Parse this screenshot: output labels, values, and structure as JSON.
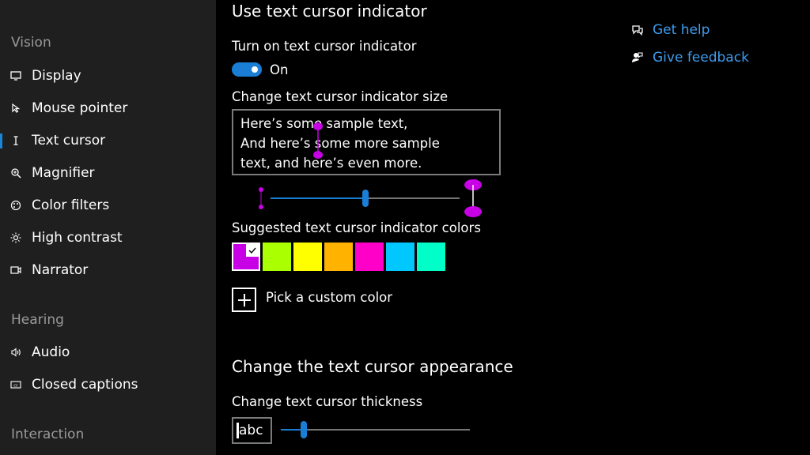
{
  "sidebar": {
    "sections": [
      {
        "header": "Vision",
        "items": [
          {
            "label": "Display",
            "icon": "display-icon"
          },
          {
            "label": "Mouse pointer",
            "icon": "mouse-pointer-icon"
          },
          {
            "label": "Text cursor",
            "icon": "text-cursor-icon",
            "selected": true
          },
          {
            "label": "Magnifier",
            "icon": "magnifier-icon"
          },
          {
            "label": "Color filters",
            "icon": "color-filters-icon"
          },
          {
            "label": "High contrast",
            "icon": "high-contrast-icon"
          },
          {
            "label": "Narrator",
            "icon": "narrator-icon"
          }
        ]
      },
      {
        "header": "Hearing",
        "items": [
          {
            "label": "Audio",
            "icon": "audio-icon"
          },
          {
            "label": "Closed captions",
            "icon": "closed-captions-icon"
          }
        ]
      },
      {
        "header": "Interaction",
        "items": []
      }
    ]
  },
  "main": {
    "title": "Use text cursor indicator",
    "toggle_label": "Turn on text cursor indicator",
    "toggle_state": "On",
    "toggle_on": true,
    "size_label": "Change text cursor indicator size",
    "sample_lines": [
      "Here’s some sample text,",
      "And here’s some more sample",
      "text, and here’s even more."
    ],
    "size_slider_value": 0.5,
    "colors_label": "Suggested text cursor indicator colors",
    "colors": [
      "#c800e6",
      "#aaff00",
      "#ffff00",
      "#ffb300",
      "#ff00c8",
      "#00c8ff",
      "#00ffc8"
    ],
    "selected_color_index": 0,
    "custom_color_label": "Pick a custom color",
    "section2_title": "Change the text cursor appearance",
    "thickness_label": "Change text cursor thickness",
    "thickness_preview": "abc",
    "thickness_slider_value": 0.12
  },
  "links": {
    "help": "Get help",
    "feedback": "Give feedback"
  },
  "accent_color": "#1a7fd4",
  "link_color": "#3d9cf0",
  "indicator_color": "#c800e6"
}
